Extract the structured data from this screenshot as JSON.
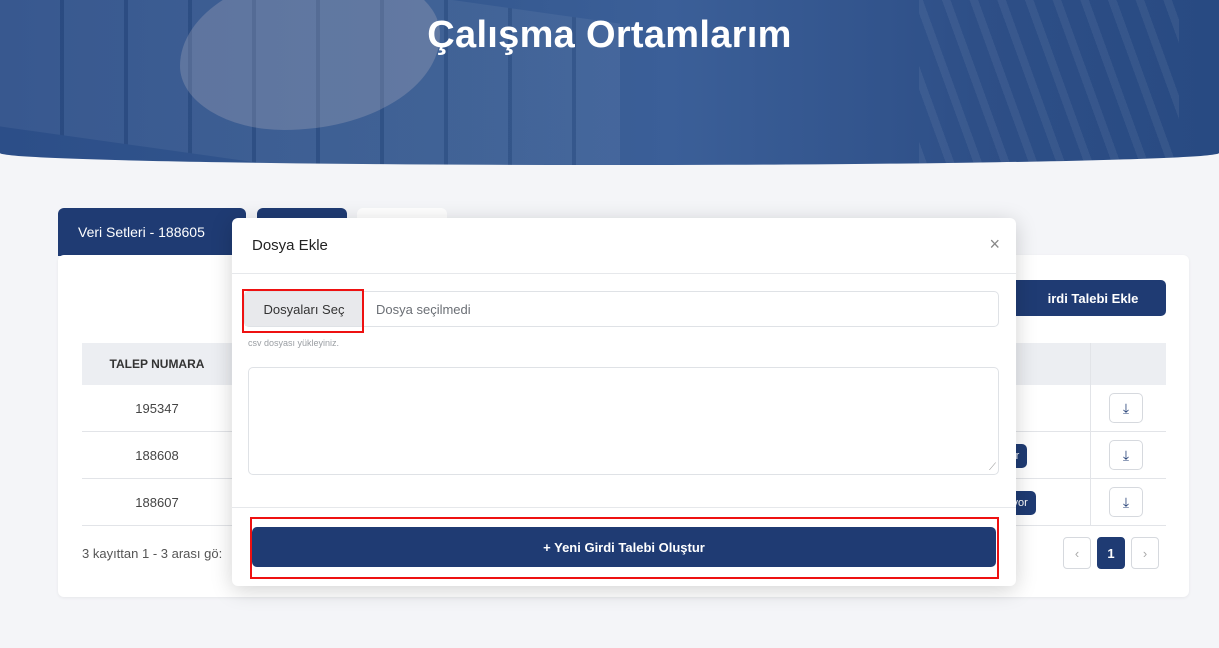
{
  "hero": {
    "title": "Çalışma Ortamlarım"
  },
  "tabs": [
    {
      "label": "Veri Setleri - 188605"
    },
    {
      "label": ""
    },
    {
      "label": ""
    }
  ],
  "card": {
    "add_button_label": "irdi Talebi Ekle",
    "table": {
      "header_first": "TALEP NUMARA",
      "rows": [
        {
          "id": "195347",
          "status": "",
          "status_color": "#2db34a"
        },
        {
          "id": "188608",
          "status": "yor",
          "status_color": "#1f3b73"
        },
        {
          "id": "188607",
          "status": "hiyor",
          "status_color": "#1f3b73"
        }
      ]
    },
    "footer_info": "3 kayıttan 1 - 3 arası gö:",
    "pagination": {
      "prev": "‹",
      "current": "1",
      "next": "›"
    }
  },
  "modal": {
    "title": "Dosya Ekle",
    "close_icon": "×",
    "file_button": "Dosyaları Seç",
    "file_status": "Dosya seçilmedi",
    "hint": "csv dosyası yükleyiniz.",
    "textarea_value": "",
    "create_button": "+ Yeni Girdi Talebi Oluştur"
  },
  "colors": {
    "primary": "#1f3b73",
    "highlight": "#e11111",
    "success": "#2db34a"
  }
}
